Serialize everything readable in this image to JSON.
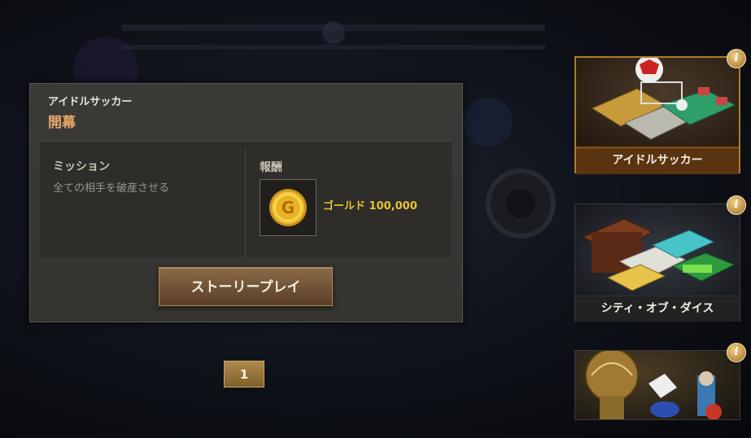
{
  "story": {
    "category": "アイドルサッカー",
    "title": "開幕",
    "mission_heading": "ミッション",
    "mission_text": "全ての相手を破産させる",
    "reward_heading": "報酬",
    "reward_icon": "gold-coin-icon",
    "reward_text": "ゴールド 100,000",
    "play_button": "ストーリープレイ"
  },
  "pagination": {
    "current_page": "1"
  },
  "side_cards": [
    {
      "label": "アイドルサッカー",
      "selected": true
    },
    {
      "label": "シティ・オブ・ダイス",
      "selected": false
    },
    {
      "label": "",
      "selected": false
    }
  ],
  "colors": {
    "title_orange": "#e6a66b",
    "reward_gold": "#e8c332",
    "selected_border": "#b07a2c"
  }
}
